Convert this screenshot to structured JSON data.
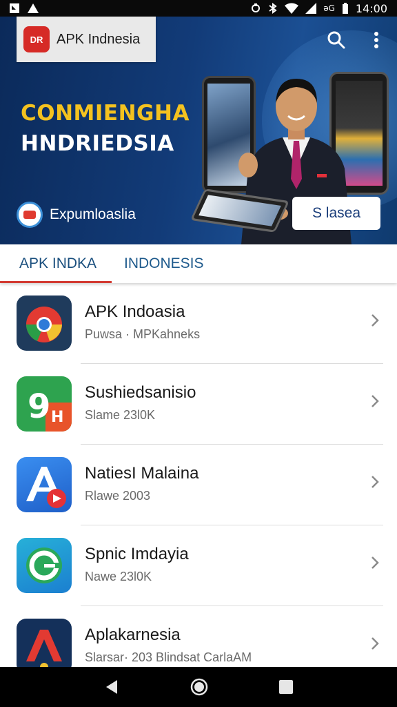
{
  "status_bar": {
    "carrier_text": "əG",
    "time": "14:00",
    "icons": [
      "notification-icon",
      "alert-icon",
      "sync-icon",
      "bluetooth-icon",
      "wifi-icon",
      "signal-icon",
      "battery-icon"
    ]
  },
  "app_bar": {
    "title": "APK Indnesia",
    "logo_text": "DR",
    "actions": [
      "search-icon",
      "more-vert-icon"
    ]
  },
  "hero": {
    "headline_line1": "CONMIENGHA",
    "headline_line2": "HNDRIEDSIA",
    "brand_text": "Expumloaslia",
    "button_label": "S lasea",
    "colors": {
      "headline_accent": "#f4c21f",
      "background": "#123b78"
    }
  },
  "tabs": [
    {
      "label": "APK INDKA",
      "active": true
    },
    {
      "label": "INDONESIS",
      "active": false
    }
  ],
  "apps": [
    {
      "name": "APK Indoasia",
      "meta": "Puwsa · MPKahneks",
      "icon": "chrome-style-icon"
    },
    {
      "name": "Sushiedsanisio",
      "meta": "Slame 23l0K",
      "icon": "g9-icon"
    },
    {
      "name": "NatiesI Malaina",
      "meta": "Rlawe 2003",
      "icon": "a-store-icon"
    },
    {
      "name": "Spnic Imdayia",
      "meta": "Nawe 23l0K",
      "icon": "g-refresh-icon"
    },
    {
      "name": "Aplakarnesia",
      "meta": "Slarsar· 203 Blindsat CarlaAM",
      "icon": "red-a-icon"
    }
  ],
  "nav_bar": {
    "icons": [
      "back-icon",
      "home-icon",
      "recents-icon"
    ]
  },
  "accent_color": "#d33b33"
}
